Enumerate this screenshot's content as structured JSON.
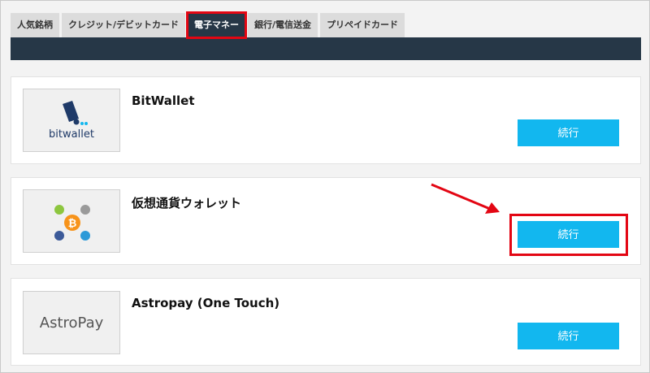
{
  "tabs": [
    {
      "label": "人気銘柄",
      "active": false
    },
    {
      "label": "クレジット/デビットカード",
      "active": false
    },
    {
      "label": "電子マネー",
      "active": true
    },
    {
      "label": "銀行/電信送金",
      "active": false
    },
    {
      "label": "プリペイドカード",
      "active": false
    }
  ],
  "cards": [
    {
      "title": "BitWallet",
      "logo_text": "bitwallet",
      "button_label": "続行"
    },
    {
      "title": "仮想通貨ウォレット",
      "logo_icon": "crypto-coins-icon",
      "button_label": "続行"
    },
    {
      "title": "Astropay (One Touch)",
      "logo_text": "AstroPay",
      "button_label": "続行"
    }
  ],
  "colors": {
    "nav_bar": "#263747",
    "button": "#12b7ef",
    "highlight": "#e30613",
    "bitcoin": "#f7931a"
  }
}
